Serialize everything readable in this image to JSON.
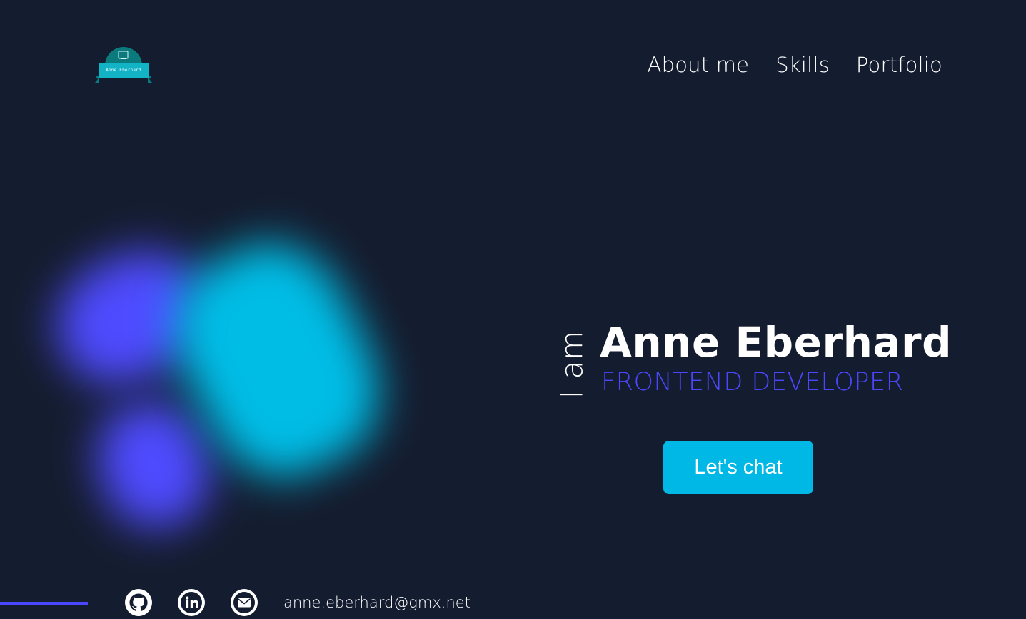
{
  "header": {
    "logo": {
      "text": "Anne Eberhard",
      "icon": "coding-computer-logo-icon"
    },
    "nav": {
      "items": [
        {
          "label": "About me"
        },
        {
          "label": "Skills"
        },
        {
          "label": "Portfolio"
        }
      ]
    }
  },
  "hero": {
    "intro": "I am",
    "name": "Anne Eberhard",
    "role": "FRONTEND DEVELOPER",
    "cta_label": "Let's chat"
  },
  "footer": {
    "social": [
      {
        "icon": "github-icon"
      },
      {
        "icon": "linkedin-icon"
      },
      {
        "icon": "mail-icon"
      }
    ],
    "email": "anne.eberhard@gmx.net"
  },
  "colors": {
    "background": "#141c2f",
    "accent_cyan": "#00b8e6",
    "accent_purple": "#4b47ff",
    "text": "#ffffff"
  }
}
